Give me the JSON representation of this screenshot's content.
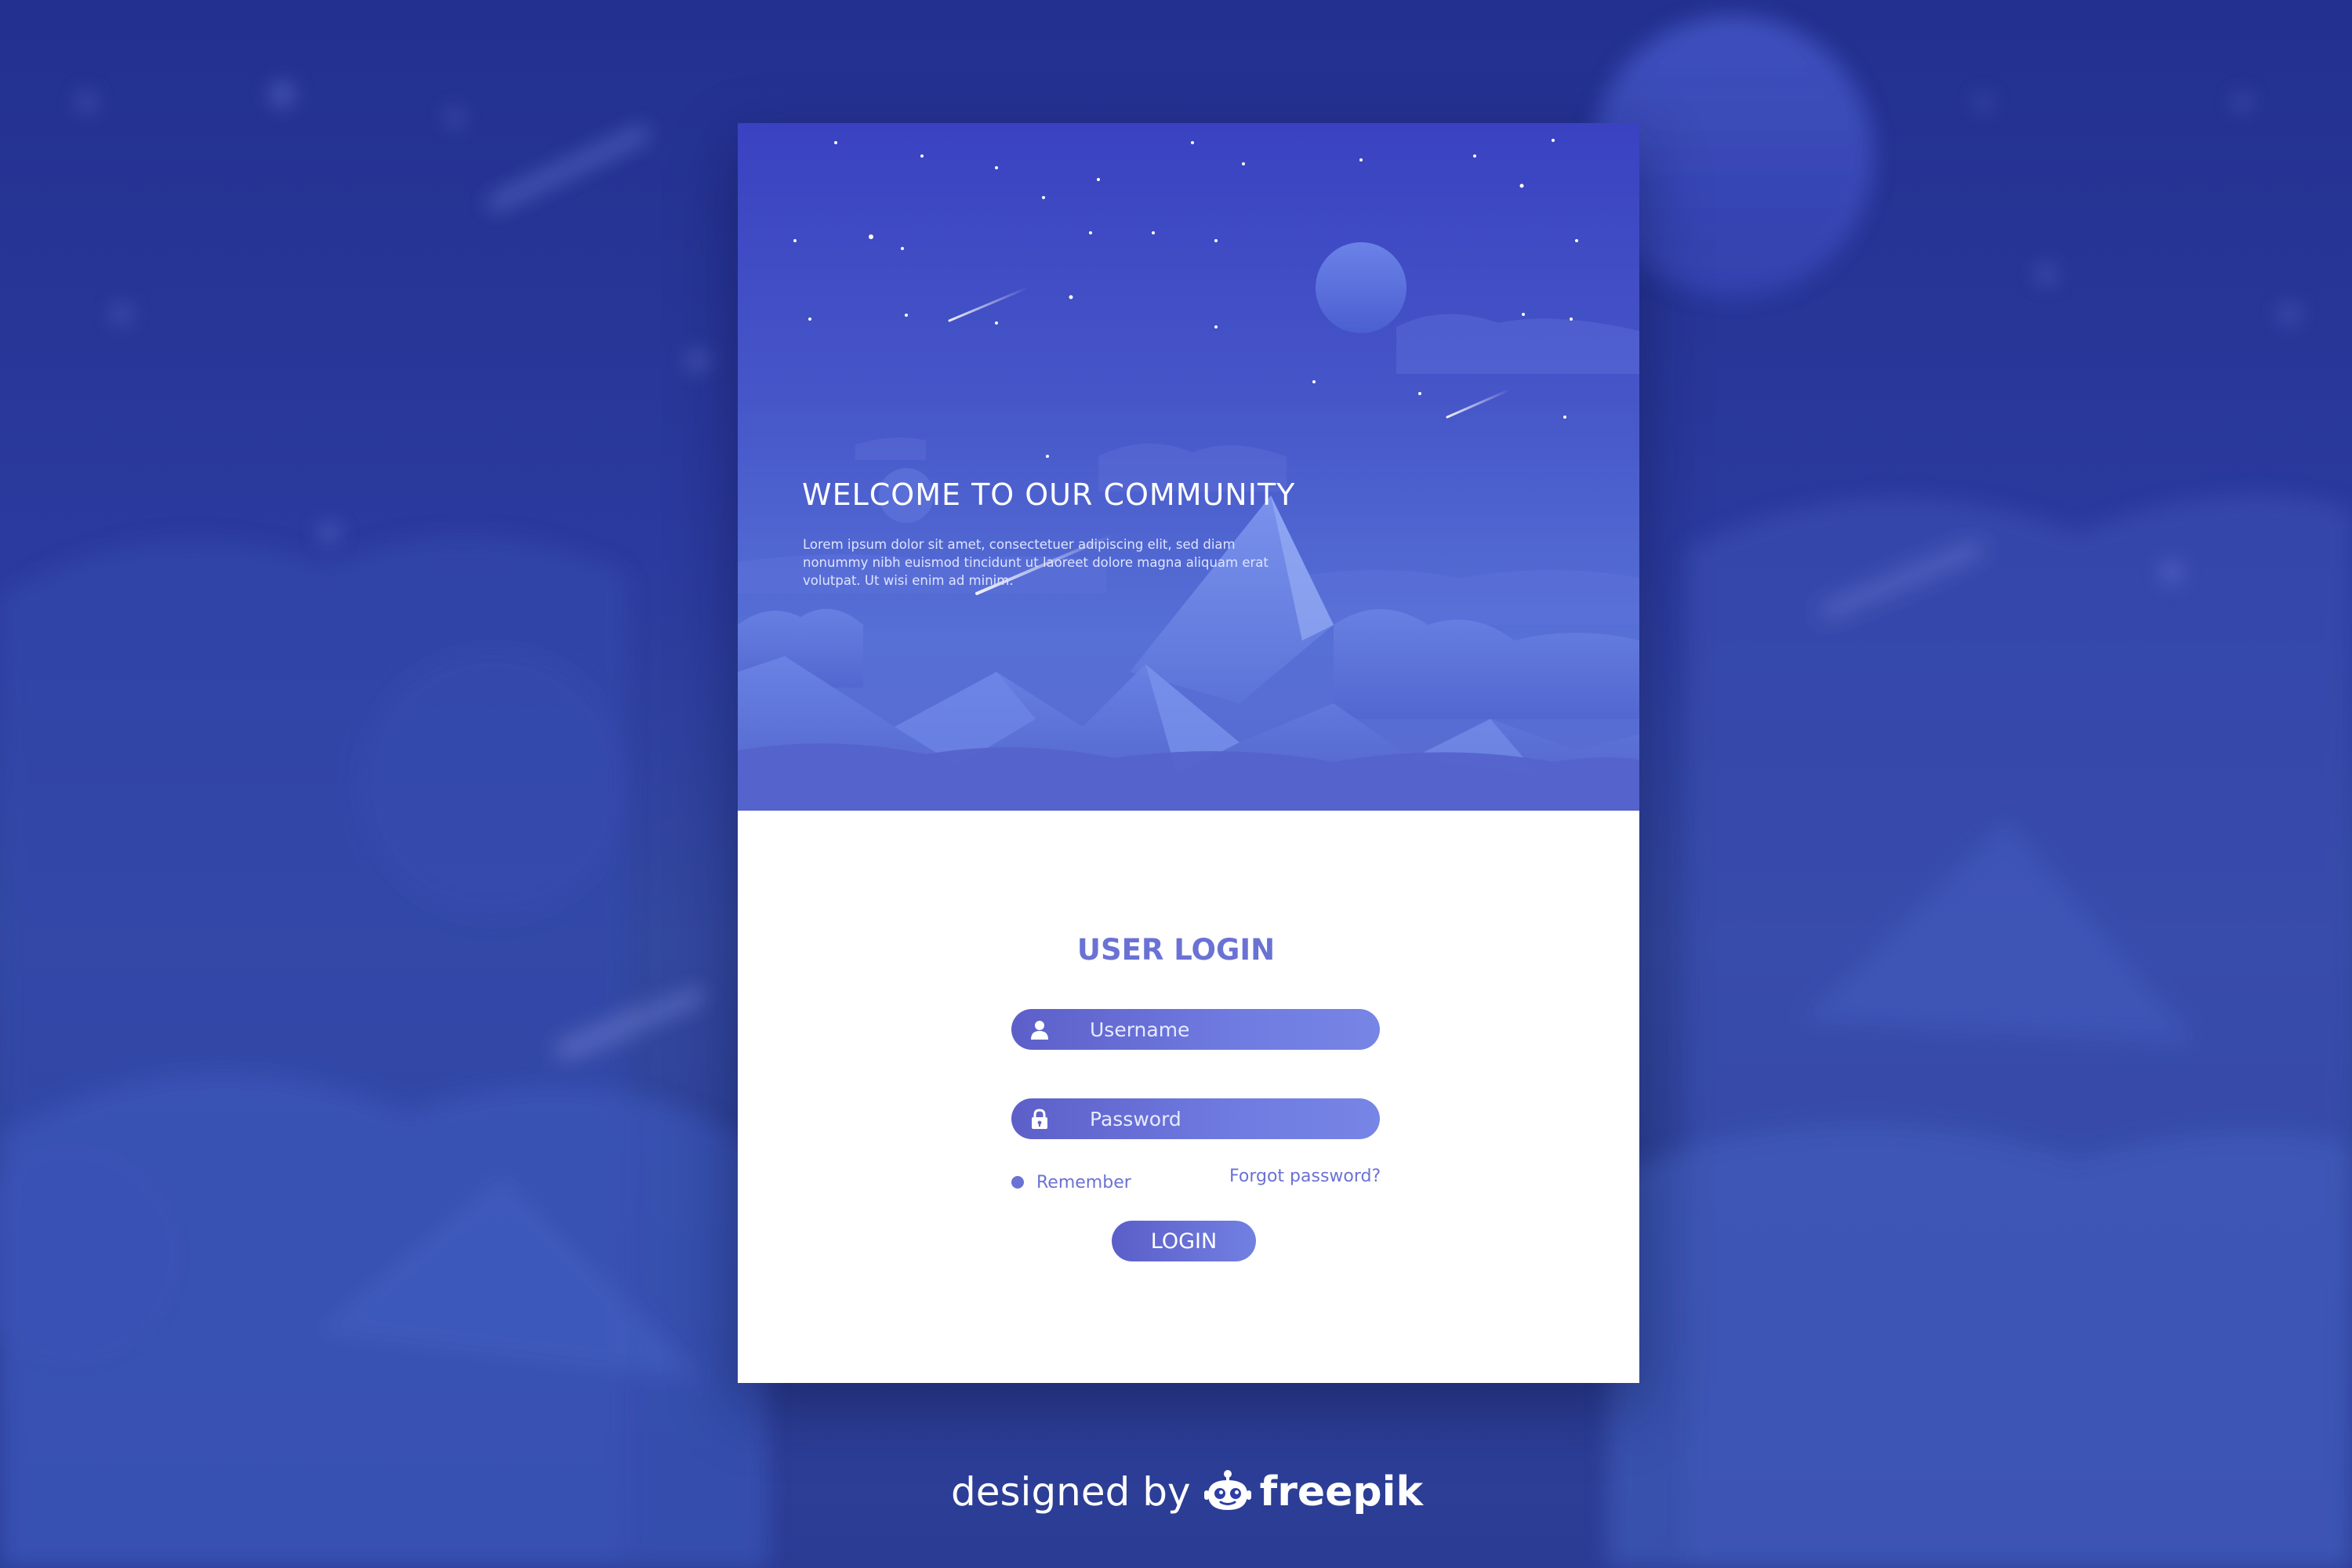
{
  "hero": {
    "title": "WELCOME TO OUR COMMUNITY",
    "body": "Lorem ipsum dolor sit amet, consectetuer adipiscing elit, sed diam nonummy nibh euismod tincidunt ut laoreet dolore magna aliquam erat volutpat. Ut wisi enim ad minim."
  },
  "login": {
    "title": "USER LOGIN",
    "username_placeholder": "Username",
    "password_placeholder": "Password",
    "remember_label": "Remember",
    "forgot_label": "Forgot password?",
    "submit_label": "LOGIN"
  },
  "footer": {
    "designed_by": "designed by",
    "brand": "freepik"
  },
  "icons": {
    "username": "user-icon",
    "password": "lock-icon",
    "brand": "freepik-logo-icon"
  },
  "colors": {
    "accent": "#6a72d4",
    "background": "#2b3a9e",
    "field_gradient_start": "#5d5fc9",
    "field_gradient_end": "#7785e6"
  }
}
